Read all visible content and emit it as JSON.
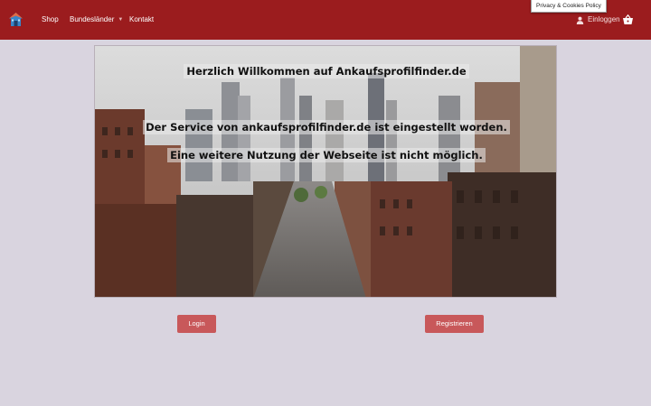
{
  "header": {
    "logo_icon": "house-icon",
    "nav": {
      "shop": "Shop",
      "bundeslaender": "Bundesländer",
      "kontakt": "Kontakt"
    },
    "login_label": "Einloggen",
    "user_icon": "user-icon",
    "cart_icon": "basket-icon",
    "privacy_label": "Privacy & Cookies Policy"
  },
  "hero": {
    "line1": "Herzlich Willkommen auf Ankaufsprofilfinder.de",
    "line2": "Der Service von ankaufsprofilfinder.de ist eingestellt worden.",
    "line3": "Eine weitere Nutzung der Webseite ist nicht möglich."
  },
  "buttons": {
    "login": "Login",
    "register": "Registrieren"
  },
  "colors": {
    "header_bg": "#9b1c1e",
    "page_bg": "#d9d4df",
    "button_bg": "#c8585a"
  }
}
